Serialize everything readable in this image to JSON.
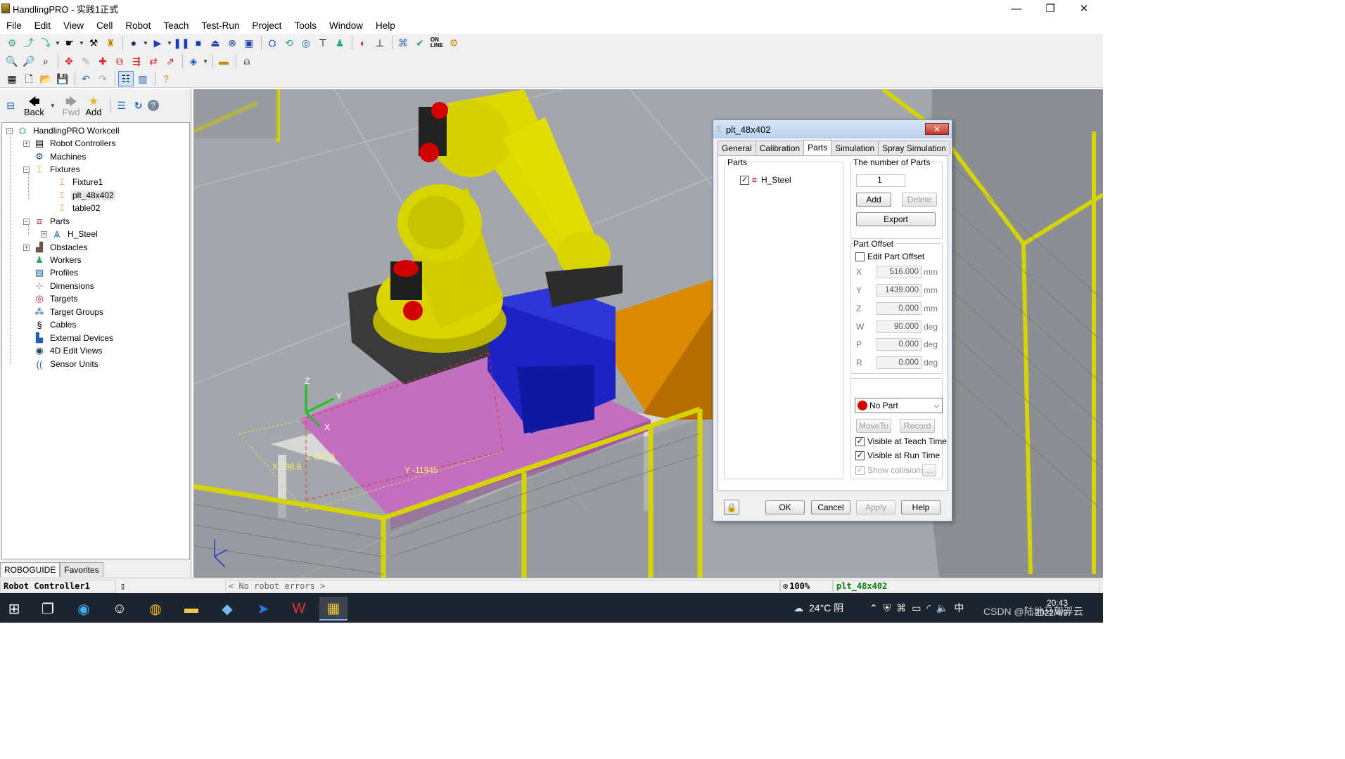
{
  "window": {
    "title": "HandlingPRO - 实践1正式",
    "minimize": "—",
    "maximize": "❐",
    "close": "✕"
  },
  "menu": [
    "File",
    "Edit",
    "View",
    "Cell",
    "Robot",
    "Teach",
    "Test-Run",
    "Project",
    "Tools",
    "Window",
    "Help"
  ],
  "nav": {
    "back": "Back",
    "fwd": "Fwd",
    "add": "Add"
  },
  "tree": {
    "root": "HandlingPRO Workcell",
    "robot_controllers": "Robot Controllers",
    "machines": "Machines",
    "fixtures": "Fixtures",
    "fixture1": "Fixture1",
    "plt": "plt_48x402",
    "table02": "table02",
    "parts": "Parts",
    "h_steel": "H_Steel",
    "obstacles": "Obstacles",
    "workers": "Workers",
    "profiles": "Profiles",
    "dimensions": "Dimensions",
    "targets": "Targets",
    "target_groups": "Target Groups",
    "cables": "Cables",
    "external_devices": "External Devices",
    "edit_views": "4D Edit Views",
    "sensor_units": "Sensor Units"
  },
  "bottom_tabs": {
    "roboguide": "ROBOGUIDE",
    "favorites": "Favorites"
  },
  "scene": {
    "label_x": "X 738.8",
    "label_z": "Z 697.0",
    "label_y": "Y -11945",
    "axis_z": "Z",
    "axis_y": "Y",
    "axis_x": "X"
  },
  "dialog": {
    "title": "plt_48x402",
    "tabs": [
      "General",
      "Calibration",
      "Parts",
      "Simulation",
      "Spray Simulation"
    ],
    "parts_group": "Parts",
    "part_item": "H_Steel",
    "num_parts_label": "The number of Parts",
    "num_parts_value": "1",
    "add": "Add",
    "delete": "Delete",
    "export": "Export",
    "offset_group": "Part Offset",
    "edit_offset": "Edit Part Offset",
    "offsets": [
      {
        "axis": "X",
        "value": "516.000",
        "unit": "mm"
      },
      {
        "axis": "Y",
        "value": "1439.000",
        "unit": "mm"
      },
      {
        "axis": "Z",
        "value": "0.000",
        "unit": "mm"
      },
      {
        "axis": "W",
        "value": "90.000",
        "unit": "deg"
      },
      {
        "axis": "P",
        "value": "0.000",
        "unit": "deg"
      },
      {
        "axis": "R",
        "value": "0.000",
        "unit": "deg"
      }
    ],
    "no_part": "No Part",
    "moveto": "MoveTo",
    "record": "Record",
    "visible_teach": "Visible at Teach Time",
    "visible_run": "Visible at Run Time",
    "show_collisions": "Show collisions",
    "ellipsis": "...",
    "ok": "OK",
    "cancel": "Cancel",
    "apply": "Apply",
    "help": "Help"
  },
  "status": {
    "controller": "Robot Controller1",
    "errors": "< No robot errors >",
    "zoom": "100%",
    "selected": "plt_48x402"
  },
  "taskbar": {
    "weather": "24°C 阴",
    "ime": "中",
    "time": "20:43",
    "date": "2022/4/9",
    "watermark": "CSDN @陆地马驾浮云"
  }
}
